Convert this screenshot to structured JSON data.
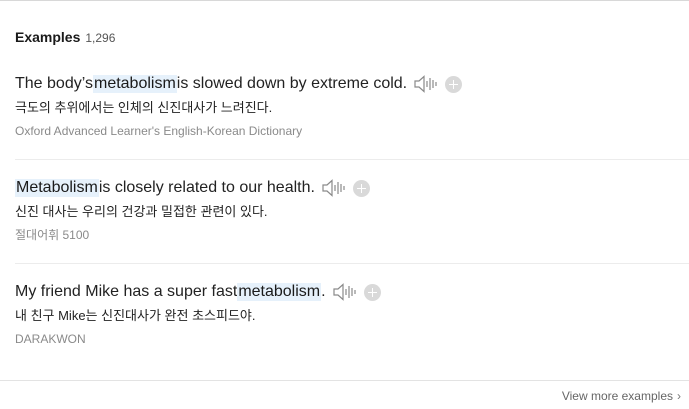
{
  "header": {
    "title": "Examples",
    "count": "1,296"
  },
  "examples": [
    {
      "en_before": "The body’s ",
      "en_highlight": "metabolism",
      "en_after": " is slowed down by extreme cold.",
      "ko": "극도의 추위에서는 인체의 신진대사가 느려진다.",
      "source": "Oxford Advanced Learner's English-Korean Dictionary"
    },
    {
      "en_before": "",
      "en_highlight": "Metabolism",
      "en_after": " is closely related to our health.",
      "ko": "신진 대사는 우리의 건강과 밀접한 관련이 있다.",
      "source": "절대어휘 5100"
    },
    {
      "en_before": "My friend Mike has a super fast ",
      "en_highlight": "metabolism",
      "en_after": ".",
      "ko": "내 친구 Mike는 신진대사가 완전 초스피드야.",
      "source": "DARAKWON"
    }
  ],
  "footer": {
    "view_more": "View more examples",
    "chevron": "›"
  },
  "icons": {
    "speaker": "speaker-icon",
    "add": "plus-circle-icon"
  },
  "colors": {
    "highlight_bg": "#e6f1fb",
    "source_text": "#8a8a8a",
    "plus_bg": "#d9d9d9"
  }
}
